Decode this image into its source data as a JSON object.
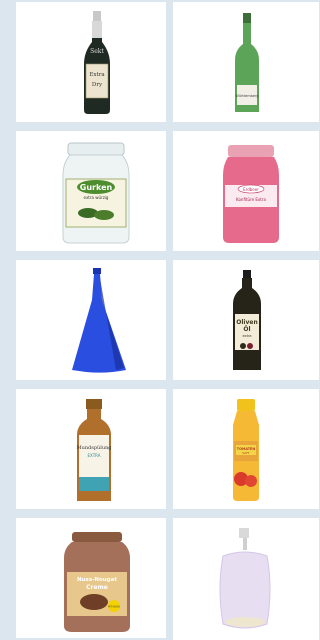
{
  "products": [
    {
      "id": "sekt",
      "kind": "sekt bottle",
      "label_lines": [
        "Sekt",
        "Extra",
        "Dry"
      ]
    },
    {
      "id": "wine",
      "kind": "green wine bottle",
      "label_lines": [
        "Württemberg"
      ]
    },
    {
      "id": "gurken",
      "kind": "pickle jar",
      "label_lines": [
        "Gurken",
        "extra würzig"
      ]
    },
    {
      "id": "konfituere",
      "kind": "jam jar",
      "label_lines": [
        "Erdbeer",
        "Konfitüre Extra"
      ]
    },
    {
      "id": "blue-bottle",
      "kind": "blue glass bottle",
      "label_lines": []
    },
    {
      "id": "olivenoel",
      "kind": "oil bottle",
      "label_lines": [
        "Oliven",
        "Öl",
        "extra"
      ]
    },
    {
      "id": "mundspuelung",
      "kind": "brown bottle",
      "label_lines": [
        "Mundspülung",
        "EXTRA"
      ]
    },
    {
      "id": "tomatensaft",
      "kind": "juice bottle",
      "label_lines": [
        "TOMATEN",
        "SAFT"
      ]
    },
    {
      "id": "nuss-nougat",
      "kind": "nougat jar",
      "label_lines": [
        "Nuss-Nougat",
        "Creme",
        "MIT KAKAO"
      ]
    },
    {
      "id": "perfume",
      "kind": "perfume flask",
      "label_lines": []
    }
  ]
}
